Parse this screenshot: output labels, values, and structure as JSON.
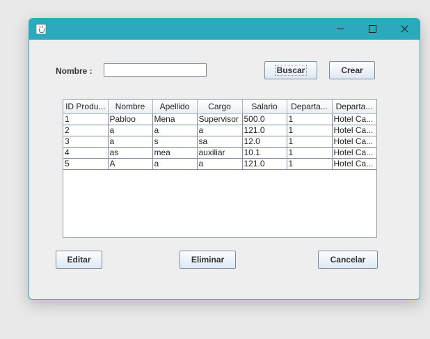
{
  "window": {
    "title": ""
  },
  "search": {
    "label": "Nombre :",
    "value": "",
    "placeholder": ""
  },
  "buttons": {
    "buscar": "Buscar",
    "crear": "Crear",
    "editar": "Editar",
    "eliminar": "Eliminar",
    "cancelar": "Cancelar"
  },
  "table": {
    "headers": [
      "ID Produ...",
      "Nombre",
      "Apellido",
      "Cargo",
      "Salario",
      "Departa...",
      "Departa..."
    ],
    "rows": [
      [
        "1",
        "Pabloo",
        "Mena",
        "Supervisor",
        "500.0",
        "1",
        "Hotel Ca..."
      ],
      [
        "2",
        "a",
        "a",
        "a",
        "121.0",
        "1",
        "Hotel Ca..."
      ],
      [
        "3",
        "a",
        "s",
        "sa",
        "12.0",
        "1",
        "Hotel Ca..."
      ],
      [
        "4",
        "as",
        "mea",
        "auxiliar",
        "10.1",
        "1",
        "Hotel Ca..."
      ],
      [
        "5",
        "A",
        "a",
        "a",
        "121.0",
        "1",
        "Hotel Ca..."
      ]
    ]
  },
  "colors": {
    "titlebar": "#2aaabc",
    "window_bg": "#eeeeee",
    "button_border": "#7a8a99"
  }
}
